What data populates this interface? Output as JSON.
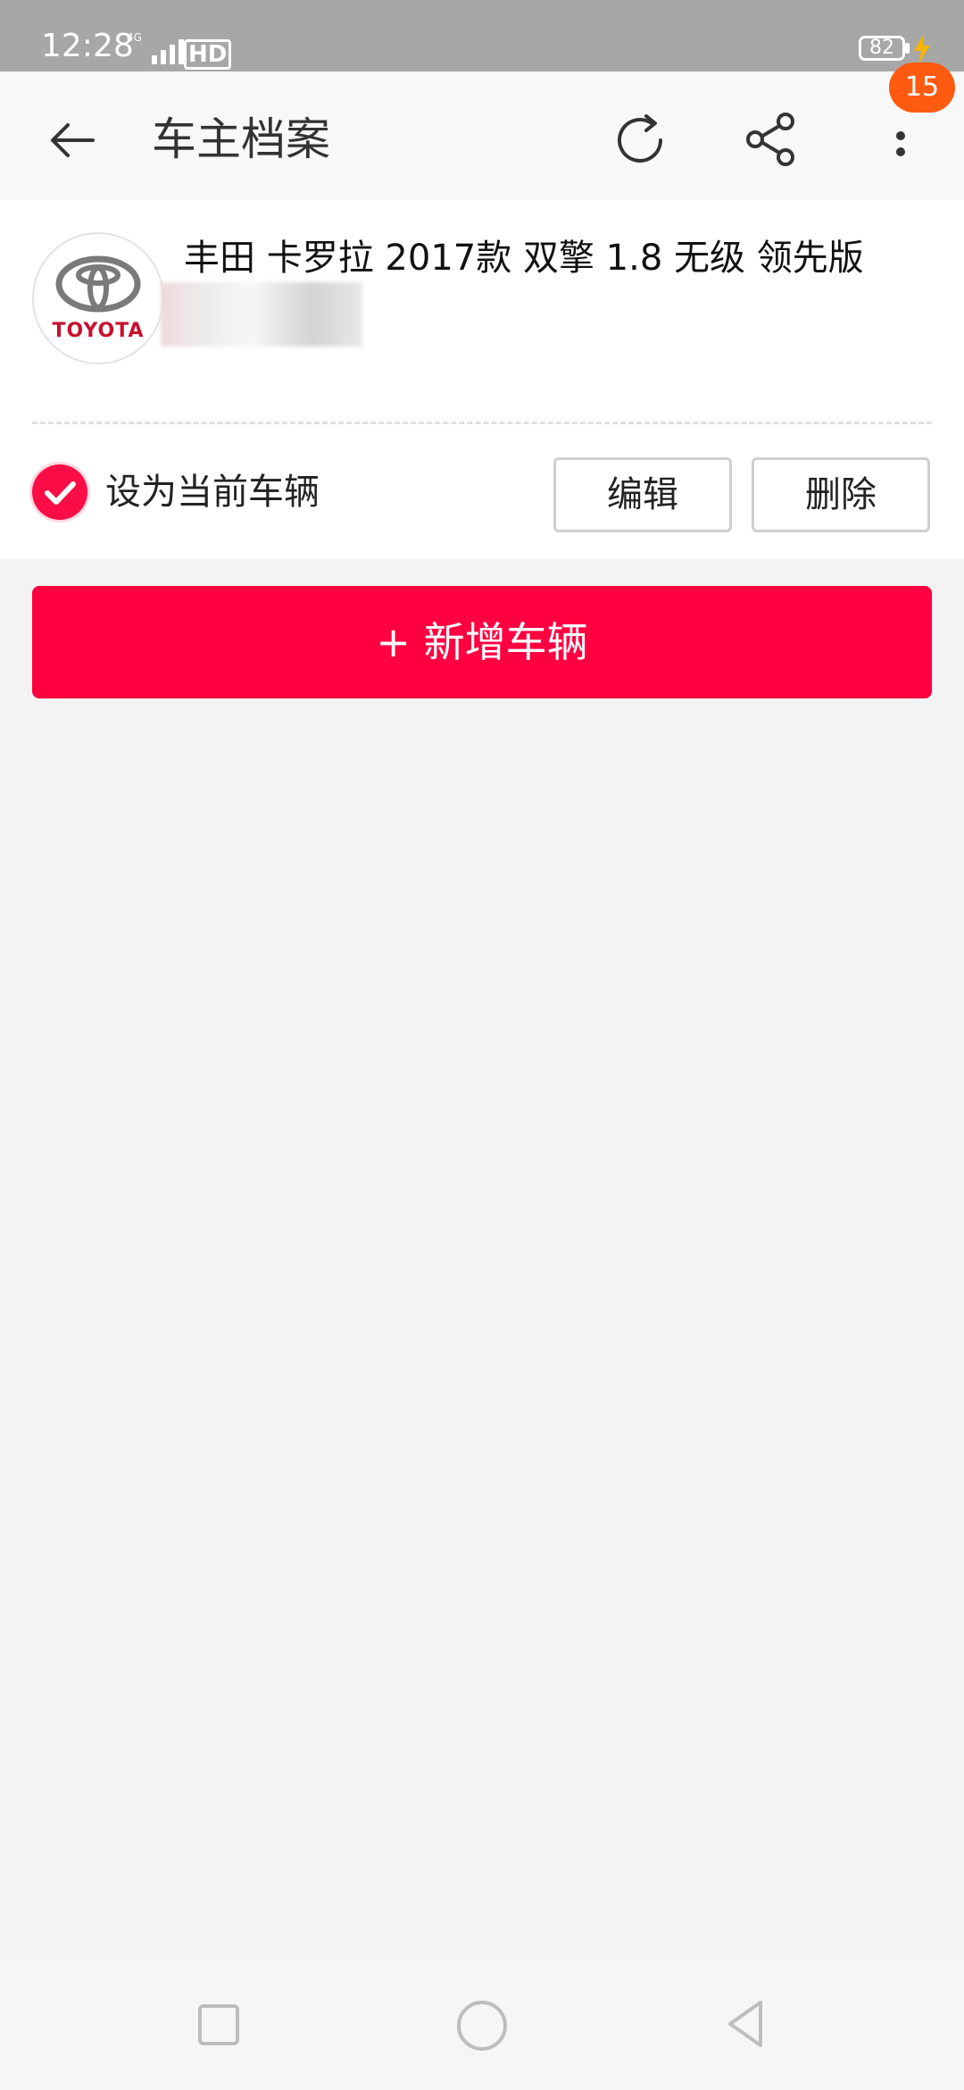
{
  "status_bar": {
    "time": "12:28",
    "network": "4G",
    "hd_label": "HD",
    "battery": "82"
  },
  "header": {
    "title": "车主档案",
    "notification_count": "15",
    "icons": [
      "back-arrow-icon",
      "refresh-icon",
      "share-icon",
      "more-vert-icon"
    ]
  },
  "vehicle": {
    "brand_logo_text": "TOYOTA",
    "name": "丰田 卡罗拉 2017款 双擎 1.8 无级 领先版",
    "set_current_label": "设为当前车辆",
    "set_current_checked": true,
    "edit_label": "编辑",
    "delete_label": "删除"
  },
  "add_vehicle_label": "+ 新增车辆",
  "colors": {
    "accent": "#ff0040",
    "badge": "#ff5b10",
    "checkbox": "#fb0d45"
  },
  "nav_bar": {
    "icons": [
      "recents-square-icon",
      "home-circle-icon",
      "back-triangle-icon"
    ]
  }
}
